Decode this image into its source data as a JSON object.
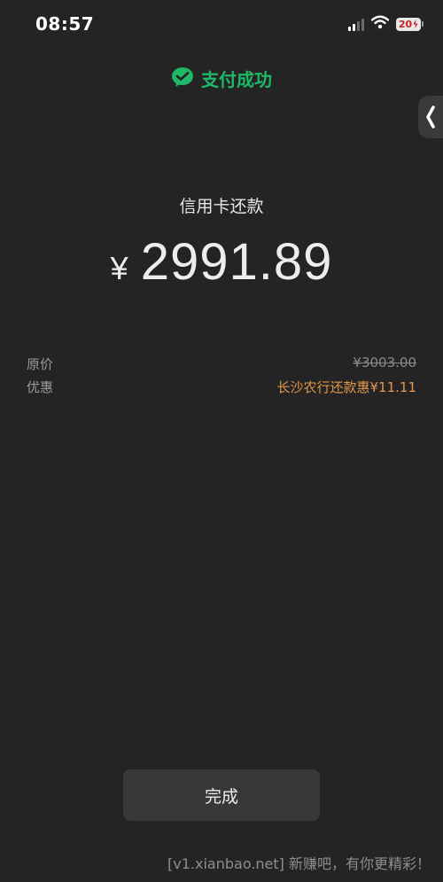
{
  "status_bar": {
    "time": "08:57",
    "battery": "20",
    "icons": [
      "signal-icon",
      "wifi-icon",
      "battery-icon"
    ]
  },
  "payment": {
    "status": "支付成功",
    "status_icon": "wechat-pay-icon",
    "merchant": "信用卡还款",
    "currency": "¥",
    "amount": "2991.89"
  },
  "details": {
    "original_label": "原价",
    "original_value": "¥3003.00",
    "discount_label": "优惠",
    "discount_value": "长沙农行还款惠¥11.11"
  },
  "done_button_label": "完成",
  "watermark": "[v1.xianbao.net] 新赚吧，有你更精彩！",
  "colors": {
    "background": "#242424",
    "success_green": "#1fb866",
    "discount_orange": "#e4984a",
    "button_bg": "#383838"
  }
}
